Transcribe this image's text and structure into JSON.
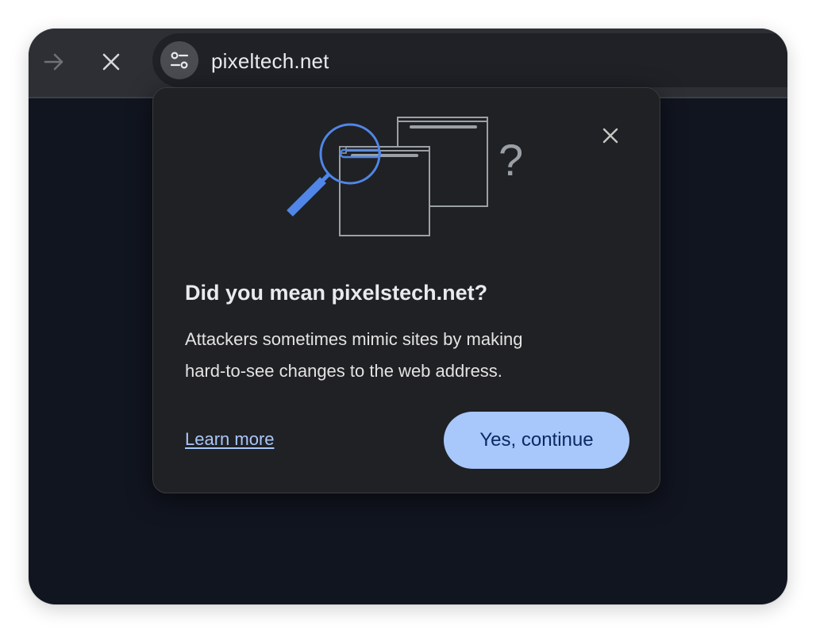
{
  "toolbar": {
    "forward_icon": "arrow-forward-icon",
    "stop_icon": "close-icon",
    "site_settings_icon": "tune-icon",
    "url": "pixeltech.net"
  },
  "popup": {
    "illustration_icon": "magnifier-windows-question-illustration",
    "question_mark": "?",
    "close_icon": "close-icon",
    "title": "Did you mean pixelstech.net?",
    "body_line1": "Attackers sometimes mimic sites by making",
    "body_line2": "hard-to-see changes to the web address.",
    "learn_more_label": "Learn more",
    "continue_label": "Yes, continue"
  },
  "colors": {
    "window_bg": "#111520",
    "toolbar_bg": "#2d2f35",
    "popup_bg": "#202124",
    "accent": "#a8c7fa",
    "accent_text": "#0b2a63",
    "magnifier_blue": "#4f86e8"
  }
}
